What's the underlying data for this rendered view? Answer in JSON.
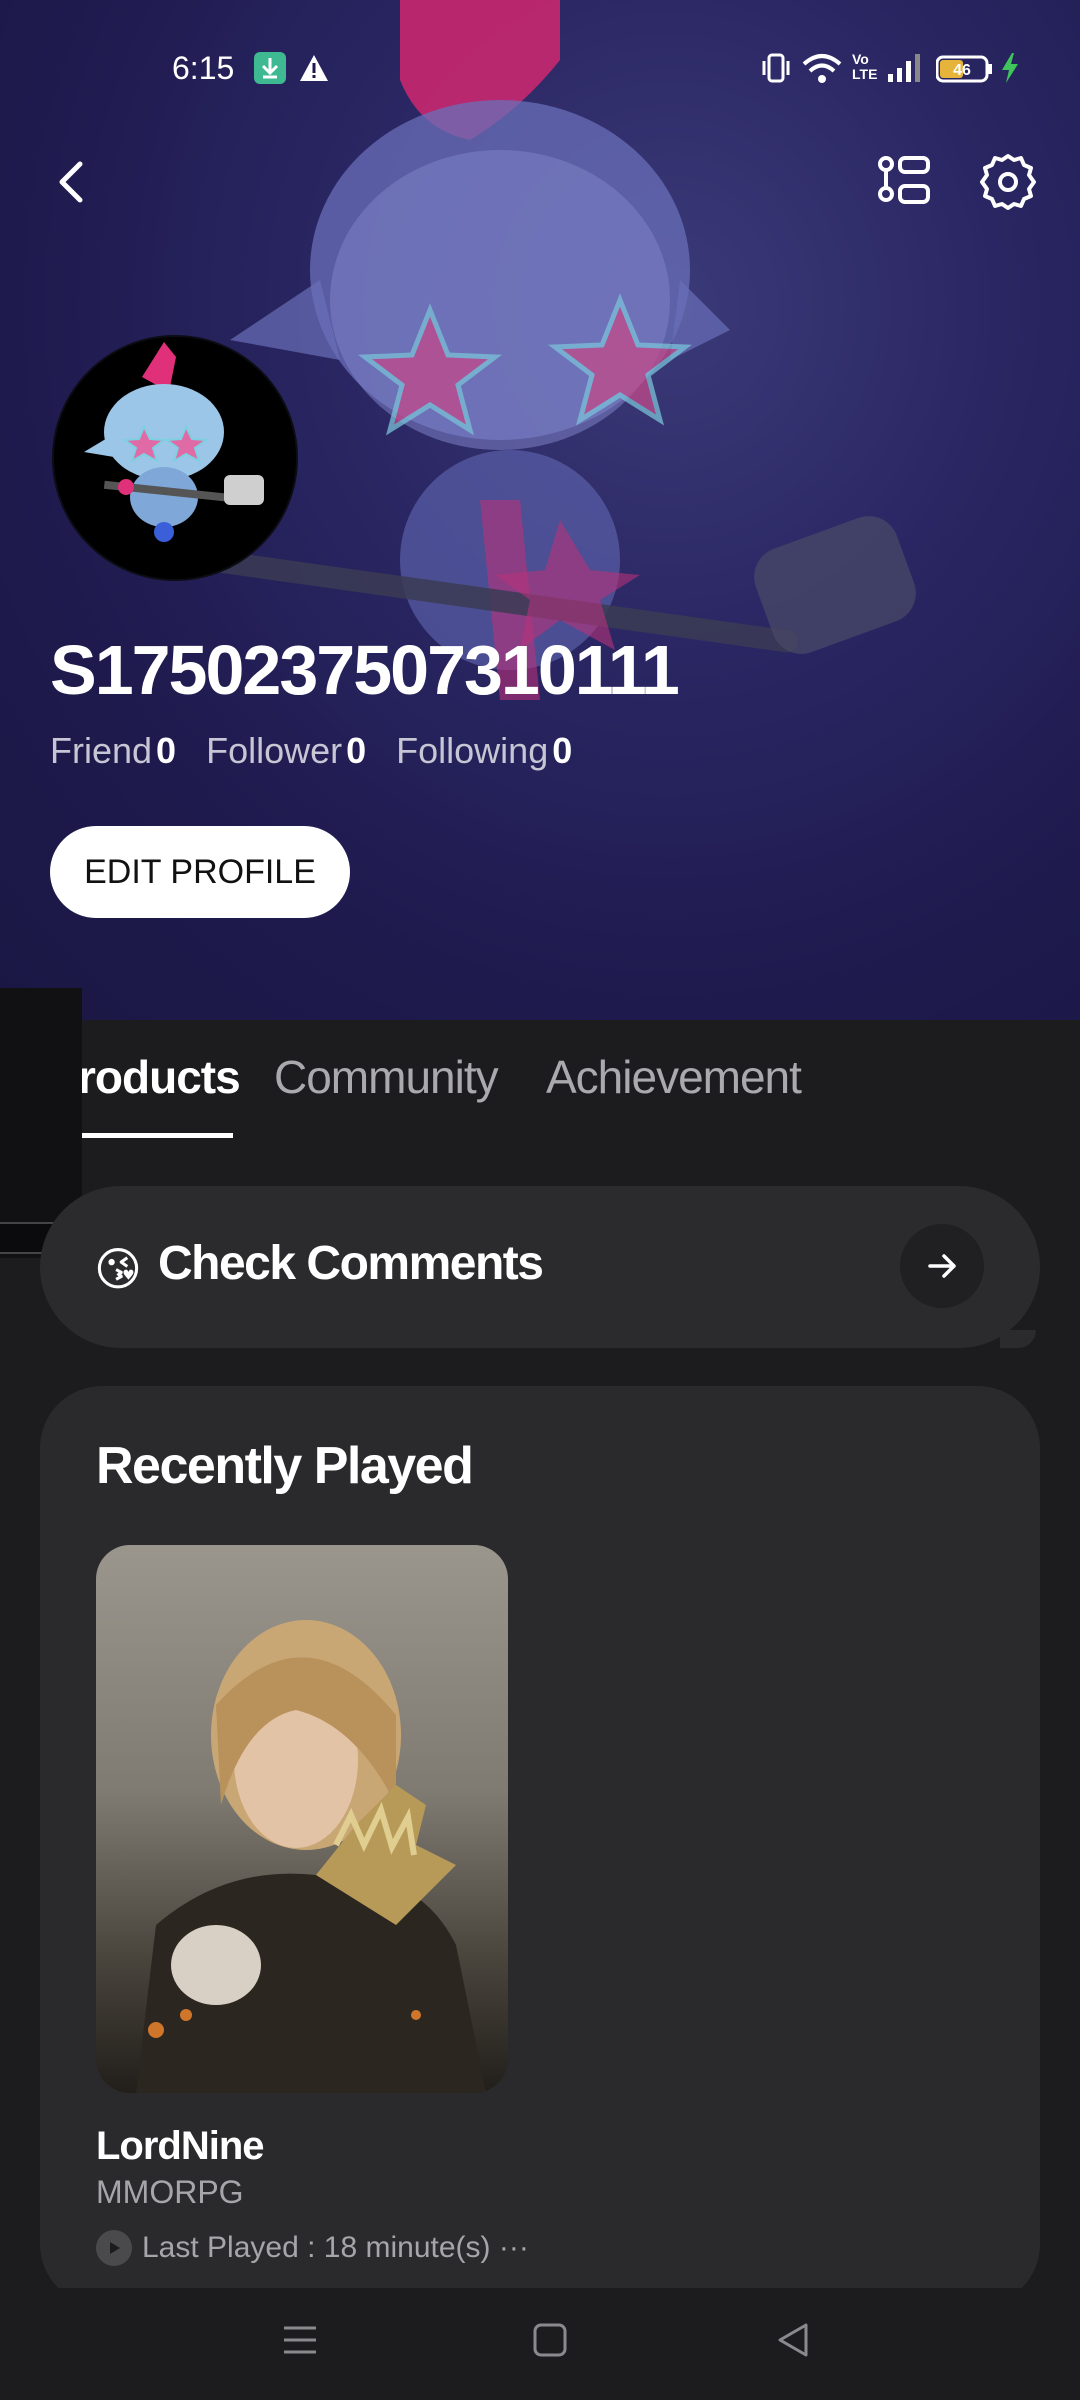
{
  "status_bar": {
    "time": "6:15",
    "battery": "46"
  },
  "header": {
    "back_icon": "chevron-left-icon",
    "list_icon": "list-settings-icon",
    "settings_icon": "gear-icon"
  },
  "profile": {
    "username": "S1750237507310111",
    "stats": [
      {
        "label": "Friend",
        "value": "0"
      },
      {
        "label": "Follower",
        "value": "0"
      },
      {
        "label": "Following",
        "value": "0"
      }
    ],
    "edit_button": "EDIT PROFILE"
  },
  "tabs": [
    {
      "label": "roducts",
      "active": true
    },
    {
      "label": "Community",
      "active": false
    },
    {
      "label": "Achievement",
      "active": false
    }
  ],
  "comments": {
    "emoji": "😘",
    "label": "Check Comments"
  },
  "recently_played": {
    "title": "Recently Played",
    "game": {
      "name": "LordNine",
      "genre": "MMORPG",
      "last_played": "Last Played : 18 minute(s) ···"
    }
  },
  "colors": {
    "hero_bg": "#1e1a4d",
    "page_bg": "#1c1c1e",
    "card_bg": "#2a2a2c",
    "accent_pink": "#d6307a"
  }
}
